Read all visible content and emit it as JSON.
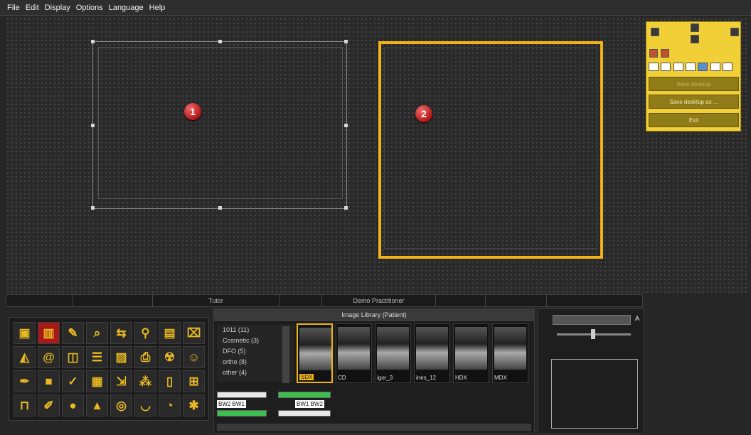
{
  "menu": {
    "file": "File",
    "edit": "Edit",
    "display": "Display",
    "options": "Options",
    "language": "Language",
    "help": "Help"
  },
  "frames": {
    "badge1": "1",
    "badge2": "2"
  },
  "yellow_panel": {
    "save_desktop": "Save desktop",
    "save_desktop_as": "Save desktop as ...",
    "exit": "Exit"
  },
  "tabs": {
    "tab3": "Tutor",
    "tab5": "Demo Practitioner"
  },
  "library": {
    "title": "Image Library (Patient)",
    "tree": [
      "1011 (11)",
      "Cosmetic (3)",
      "DFO (5)",
      "ortho (8)",
      "other (4)"
    ],
    "thumbs": [
      "SDX",
      "CD",
      "igor_3",
      "ines_12",
      "HDX",
      "MDX"
    ],
    "grid": {
      "left": "BW2 BW1",
      "right": "BW1 BW2"
    }
  },
  "right": {
    "a_label": "A"
  },
  "colors": {
    "accent": "#f0b41a",
    "badge": "#c0201f",
    "bg": "#262626"
  }
}
